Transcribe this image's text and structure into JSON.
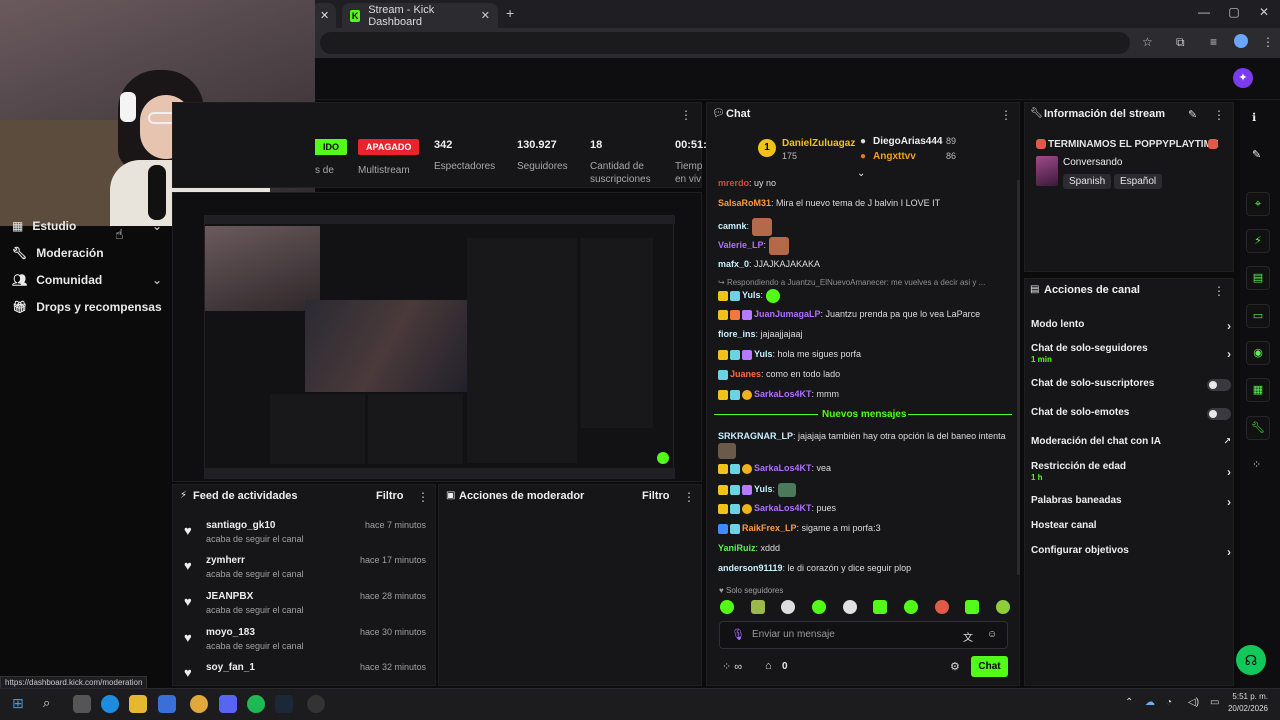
{
  "browser": {
    "tab_title": "Stream - Kick Dashboard",
    "new_tab": "+",
    "status_url": "https://dashboard.kick.com/moderation"
  },
  "sidebar": {
    "items": [
      {
        "label": "Estudio",
        "icon": "studio-icon",
        "has_chevron": true
      },
      {
        "label": "Moderación",
        "icon": "wrench-icon",
        "has_chevron": false
      },
      {
        "label": "Comunidad",
        "icon": "users-icon",
        "has_chevron": true
      },
      {
        "label": "Drops y recompensas",
        "icon": "gift-icon",
        "has_chevron": false
      }
    ]
  },
  "stats": {
    "status_badge": "IDO",
    "status_suffix": "s de",
    "multistream_badge": "APAGADO",
    "multistream_label": "Multistream",
    "viewers": {
      "value": "342",
      "label": "Espectadores"
    },
    "followers": {
      "value": "130.927",
      "label": "Seguidores"
    },
    "subs": {
      "value": "18",
      "label1": "Cantidad de",
      "label2": "suscripciones"
    },
    "time": {
      "value": "00:51:",
      "label1": "Tiemp",
      "label2": "en viv"
    }
  },
  "activity_feed": {
    "title": "Feed de actividades",
    "filter": "Filtro",
    "items": [
      {
        "user": "santiago_gk10",
        "desc": "acaba de seguir el canal",
        "time": "hace 7 minutos"
      },
      {
        "user": "zymherr",
        "desc": "acaba de seguir el canal",
        "time": "hace 17 minutos"
      },
      {
        "user": "JEANPBX",
        "desc": "acaba de seguir el canal",
        "time": "hace 28 minutos"
      },
      {
        "user": "moyo_183",
        "desc": "acaba de seguir el canal",
        "time": "hace 30 minutos"
      },
      {
        "user": "soy_fan_1",
        "desc": "acaba de seguir el canal",
        "time": "hace 32 minutos"
      }
    ]
  },
  "mod_actions": {
    "title": "Acciones de moderador",
    "filter": "Filtro"
  },
  "chat": {
    "title": "Chat",
    "leaders": [
      {
        "rank": "1",
        "name": "DanielZuluagaz",
        "amount": "175"
      },
      {
        "name": "DiegoArias444",
        "amount": "89"
      },
      {
        "name": "Angxttvv",
        "amount": "86"
      }
    ],
    "messages": [
      {
        "user": "mrerdo",
        "text": ": uy no",
        "color": "#d04a4a"
      },
      {
        "user": "SalsaRoM31",
        "text": ": Mira el nuevo tema de J balvin I LOVE IT",
        "color": "#ff9a3c"
      },
      {
        "user": "camnk",
        "text": ":",
        "color": "#c8f0ff"
      },
      {
        "user": "Valerie_LP",
        "text": ":",
        "color": "#b06dff"
      },
      {
        "user": "mafx_0",
        "text": ": JJAJKAJAKAKA",
        "color": "#c8f0ff"
      },
      {
        "user": "",
        "text": "Respondiendo a Juantzu_ElNuevoAmanecer: me vuelves a decir asi y ...",
        "color": "#8f8f8f"
      },
      {
        "user": "Yuls",
        "text": ":",
        "color": "#c8f0ff"
      },
      {
        "user": "JuanJumagaLP",
        "text": ": Juantzu prenda pa que lo vea LaParce",
        "color": "#b06dff"
      },
      {
        "user": "fiore_ins",
        "text": ": jajaajjajaaj",
        "color": "#c8f0ff"
      },
      {
        "user": "Yuls",
        "text": ": hola me sigues porfa",
        "color": "#c8f0ff"
      },
      {
        "user": "Juanes",
        "text": ": como en todo lado",
        "color": "#ff6a3c"
      },
      {
        "user": "SarkaLos4KT",
        "text": ": mmm",
        "color": "#b06dff"
      }
    ],
    "new_messages_label": "Nuevos mensajes",
    "new_messages": [
      {
        "user": "SRKRAGNAR_LP",
        "text": ": jajajaja también hay otra opción la del baneo intenta",
        "color": "#c8f0ff"
      },
      {
        "user": "SarkaLos4KT",
        "text": ": vea",
        "color": "#b06dff"
      },
      {
        "user": "Yuls",
        "text": ":",
        "color": "#c8f0ff"
      },
      {
        "user": "SarkaLos4KT",
        "text": ": pues",
        "color": "#b06dff"
      },
      {
        "user": "RaikFrex_LP",
        "text": ": sigame a mi porfa:3",
        "color": "#ff9a3c"
      },
      {
        "user": "YaniRuiz",
        "text": ": xddd",
        "color": "#5cf053"
      },
      {
        "user": "anderson91119",
        "text": ": le di corazón y dice seguir plop",
        "color": "#c8f0ff"
      }
    ],
    "followers_only": "Solo seguidores",
    "input_placeholder": "Enviar un mensaje",
    "viewer_count": "0",
    "send_button": "Chat"
  },
  "stream_info": {
    "title": "Información del stream",
    "stream_title": "TERMINAMOS EL POPPYPLAYTIME",
    "category": "Conversando",
    "tags": [
      "Spanish",
      "Español"
    ]
  },
  "channel_actions": {
    "title": "Acciones de canal",
    "items": [
      {
        "label": "Modo lento",
        "sub": "",
        "control": "chevron"
      },
      {
        "label": "Chat de solo-seguidores",
        "sub": "1 min",
        "control": "chevron"
      },
      {
        "label": "Chat de solo-suscriptores",
        "sub": "",
        "control": "toggle"
      },
      {
        "label": "Chat de solo-emotes",
        "sub": "",
        "control": "toggle"
      },
      {
        "label": "Moderación del chat con IA",
        "sub": "",
        "control": "external"
      },
      {
        "label": "Restricción de edad",
        "sub": "1 h",
        "control": "chevron"
      },
      {
        "label": "Palabras baneadas",
        "sub": "",
        "control": "chevron"
      },
      {
        "label": "Hostear canal",
        "sub": "",
        "control": "none"
      },
      {
        "label": "Configurar objetivos",
        "sub": "",
        "control": "chevron"
      }
    ]
  },
  "taskbar": {
    "time": "5:51 p. m.",
    "date": "20/02/2026"
  },
  "colors": {
    "accent": "#53fc18",
    "danger": "#e8232b",
    "panel": "#161618"
  }
}
